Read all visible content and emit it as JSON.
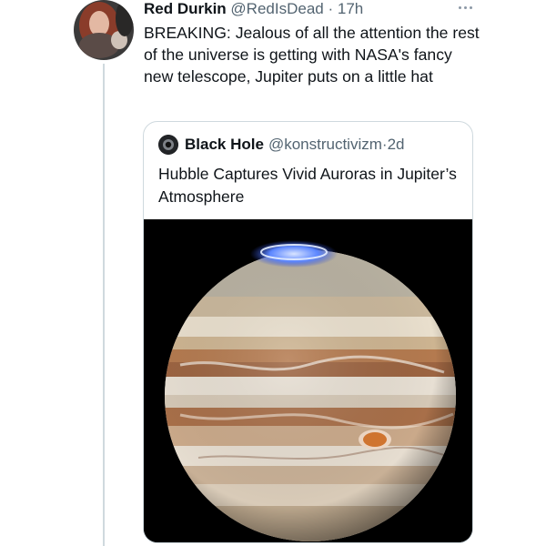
{
  "tweet": {
    "author_name": "Red Durkin",
    "author_handle": "@RedIsDead",
    "separator": "·",
    "time": "17h",
    "text": "BREAKING: Jealous of all the attention the rest of the universe is getting with NASA's fancy new telescope, Jupiter puts on a little hat"
  },
  "quoted": {
    "author_name": "Black Hole",
    "author_handle": "@konstructivizm",
    "separator": "·",
    "time": "2d",
    "text": "Hubble Captures Vivid Auroras in Jupiter’s Atmosphere"
  },
  "icons": {
    "more": "more-options-icon",
    "avatar": "profile-avatar",
    "quoted_avatar": "black-hole-avatar",
    "media": "jupiter-aurora-image"
  },
  "colors": {
    "text_primary": "#0f1419",
    "text_secondary": "#536471",
    "border": "#cfd9de",
    "aurora": "#4f7dff"
  }
}
